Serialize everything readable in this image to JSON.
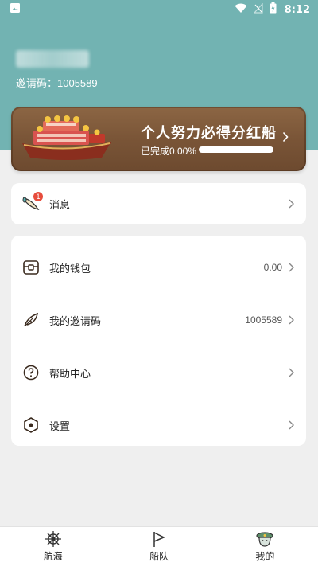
{
  "status_bar": {
    "time": "8:12",
    "icons": [
      "image-icon",
      "wifi-icon",
      "no-signal-icon",
      "battery-charging-icon"
    ]
  },
  "profile": {
    "invite_label": "邀请码：",
    "invite_code": "1005589"
  },
  "banner": {
    "title": "个人努力必得分红船",
    "progress_label": "已完成0.00%",
    "progress": 0.0
  },
  "messages": {
    "label": "消息",
    "badge": "1",
    "icon": "horn-icon"
  },
  "menu": {
    "wallet": {
      "label": "我的钱包",
      "value": "0.00",
      "icon": "wallet-chest-icon"
    },
    "invite": {
      "label": "我的邀请码",
      "value": "1005589",
      "icon": "feather-icon"
    },
    "help": {
      "label": "帮助中心",
      "icon": "question-icon"
    },
    "settings": {
      "label": "设置",
      "icon": "hexagon-nut-icon"
    }
  },
  "tabbar": {
    "tabs": [
      {
        "label": "航海",
        "icon": "ship-wheel-icon"
      },
      {
        "label": "船队",
        "icon": "flag-icon"
      },
      {
        "label": "我的",
        "icon": "captain-avatar-icon"
      }
    ],
    "active": 2
  },
  "colors": {
    "header": "#72b3b2",
    "banner": "#7a5537",
    "badge": "#e74c3c"
  }
}
